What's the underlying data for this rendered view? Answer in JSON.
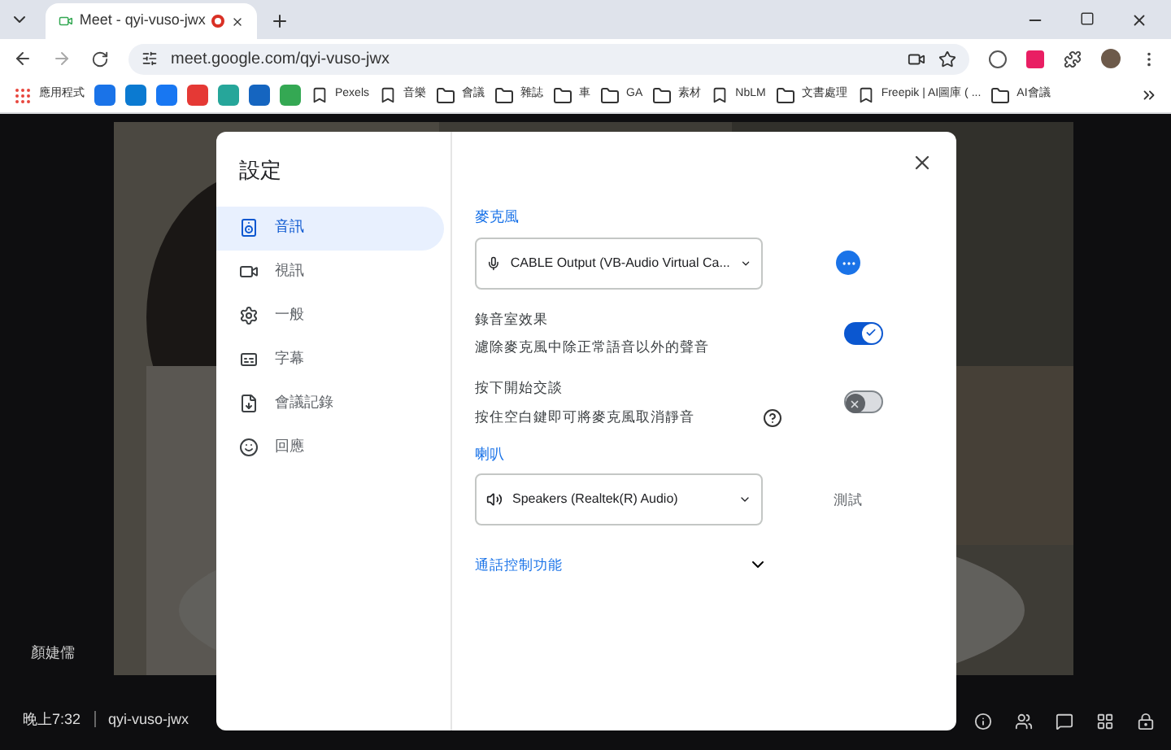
{
  "browser": {
    "tab_title": "Meet - qyi-vuso-jwx",
    "url": "meet.google.com/qyi-vuso-jwx",
    "bookmarks": [
      {
        "kind": "apps",
        "label": "應用程式"
      },
      {
        "kind": "icon"
      },
      {
        "kind": "icon"
      },
      {
        "kind": "icon"
      },
      {
        "kind": "icon"
      },
      {
        "kind": "icon"
      },
      {
        "kind": "icon"
      },
      {
        "kind": "icon"
      },
      {
        "kind": "site",
        "label": "Pexels"
      },
      {
        "kind": "site",
        "label": "音樂"
      },
      {
        "kind": "folder",
        "label": "會議"
      },
      {
        "kind": "folder",
        "label": "雜誌"
      },
      {
        "kind": "folder",
        "label": "車"
      },
      {
        "kind": "folder",
        "label": "GA"
      },
      {
        "kind": "folder",
        "label": "素材"
      },
      {
        "kind": "site",
        "label": "NbLM"
      },
      {
        "kind": "folder",
        "label": "文書處理"
      },
      {
        "kind": "site",
        "label": "Freepik | AI圖庫 ( ..."
      },
      {
        "kind": "folder",
        "label": "AI會議"
      }
    ]
  },
  "meeting": {
    "participant_name": "顏婕儒",
    "time": "晚上7:32",
    "meeting_code": "qyi-vuso-jwx"
  },
  "dialog": {
    "title": "設定",
    "nav": [
      {
        "kind": "audio",
        "label": "音訊",
        "selected": true
      },
      {
        "kind": "video",
        "label": "視訊",
        "selected": false
      },
      {
        "kind": "general",
        "label": "一般",
        "selected": false
      },
      {
        "kind": "captions",
        "label": "字幕",
        "selected": false
      },
      {
        "kind": "notes",
        "label": "會議記錄",
        "selected": false
      },
      {
        "kind": "reactions",
        "label": "回應",
        "selected": false
      }
    ],
    "microphone": {
      "heading": "麥克風",
      "device": "CABLE Output (VB-Audio Virtual Ca..."
    },
    "toggles": [
      {
        "title": "錄音室效果",
        "description": "濾除麥克風中除正常語音以外的聲音",
        "on": true,
        "help": false
      },
      {
        "title": "按下開始交談",
        "description": "按住空白鍵即可將麥克風取消靜音",
        "on": false,
        "help": true
      }
    ],
    "speakers": {
      "heading": "喇叭",
      "device": "Speakers (Realtek(R) Audio)",
      "test_label": "測試"
    },
    "call_controls": {
      "label": "通話控制功能",
      "expanded": false
    }
  }
}
